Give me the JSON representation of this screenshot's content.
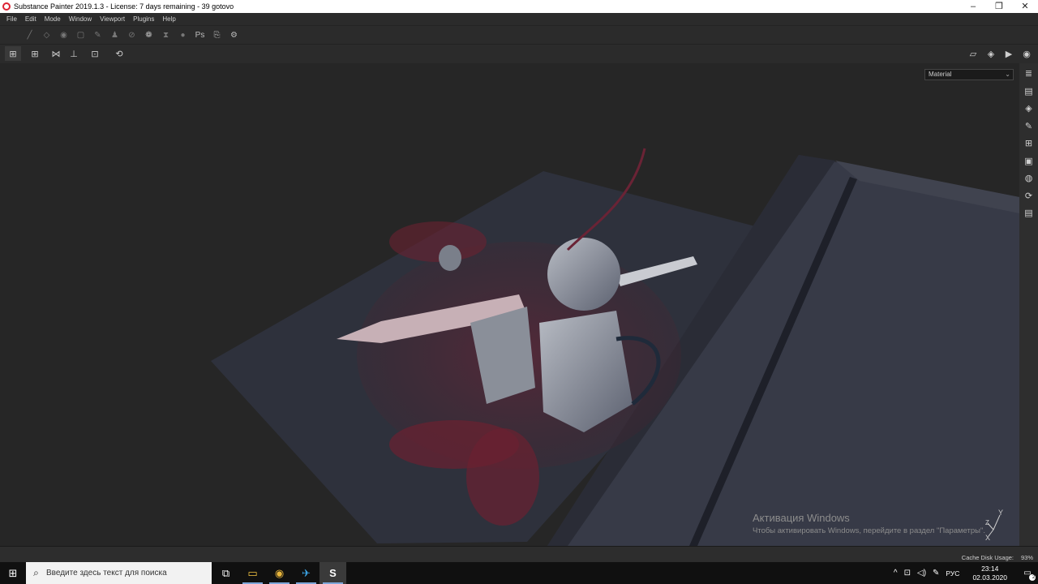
{
  "window": {
    "title": "Substance Painter 2019.1.3 - License: 7 days remaining - 39 gotovo",
    "minimize": "–",
    "restore": "❐",
    "close": "✕"
  },
  "menu": [
    "File",
    "Edit",
    "Mode",
    "Window",
    "Viewport",
    "Plugins",
    "Help"
  ],
  "toolbar": {
    "icons": [
      "paint-brush-icon",
      "eraser-icon",
      "projection-icon",
      "polygon-fill-icon",
      "smudge-icon",
      "clone-icon",
      "color-picker-icon",
      "bake-icon",
      "hourglass-icon",
      "sphere-icon",
      "photoshop-icon",
      "export-icon",
      "settings-icon"
    ],
    "glyphs": [
      "╱",
      "◇",
      "◉",
      "▢",
      "✎",
      "♟",
      "⊘",
      "❁",
      "⧗",
      "●",
      "Ps",
      "⎘",
      "⚙"
    ]
  },
  "viewport_toolbar": {
    "left_glyphs": [
      "⊞",
      "⊞",
      "⋈",
      "⊥",
      "⊡",
      "⟲"
    ],
    "right_glyphs": [
      "▱",
      "◈",
      "▶",
      "◉"
    ]
  },
  "channel_select": {
    "value": "Material"
  },
  "right_dock": {
    "glyphs": [
      "≣",
      "▤",
      "◈",
      "✎",
      "⊞",
      "▣",
      "◍",
      "⟳",
      "▤"
    ]
  },
  "watermark": {
    "line1": "Активация Windows",
    "line2": "Чтобы активировать Windows, перейдите в раздел \"Параметры\"."
  },
  "axes": {
    "y": "Y",
    "z": "Z",
    "x": "X"
  },
  "status": {
    "cache_label": "Cache Disk Usage:",
    "cache_value": "93%"
  },
  "taskbar": {
    "start_glyph": "⊞",
    "search_placeholder": "Введите здесь текст для поиска",
    "search_glyph": "⌕",
    "tasks": [
      {
        "name": "task-view",
        "glyph": "⧉"
      },
      {
        "name": "file-explorer",
        "glyph": "▭"
      },
      {
        "name": "chrome",
        "glyph": "◉"
      },
      {
        "name": "telegram",
        "glyph": "✈"
      },
      {
        "name": "substance-painter",
        "glyph": "S"
      }
    ],
    "tray": {
      "overflow": "^",
      "network": "⊡",
      "volume": "◁)",
      "pen": "✎",
      "language": "РУС",
      "time": "23:14",
      "date": "02.03.2020",
      "notifications": "▭",
      "notif_count": "2"
    }
  },
  "colors": {
    "viewport_bg": "#262626",
    "plane": "#30333f",
    "box": "#3a3d4a",
    "blood": "#6b2131",
    "metal": "#9da2ab",
    "accent": "#d23"
  }
}
